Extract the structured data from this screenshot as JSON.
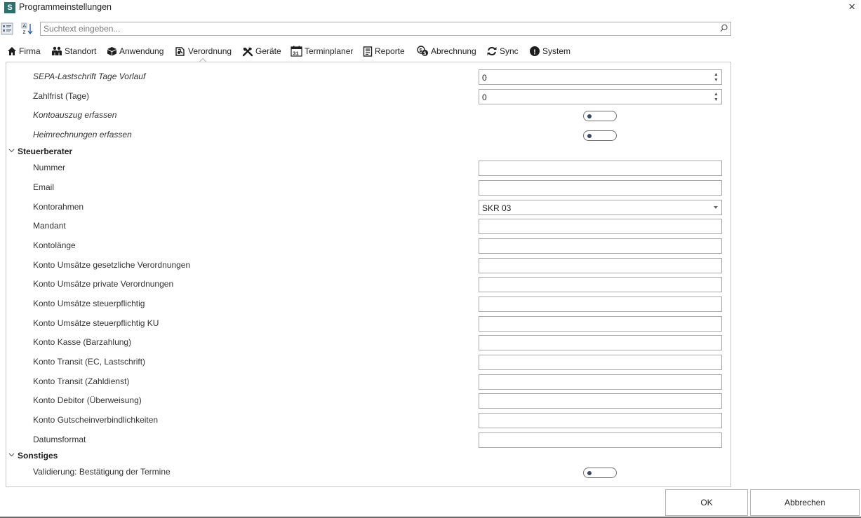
{
  "window": {
    "app_icon_letter": "S",
    "title": "Programmeinstellungen",
    "close_glyph": "×"
  },
  "toolbar": {
    "search_placeholder": "Suchtext eingeben...",
    "categorized_icon": "categorized-view-icon",
    "sort_icon": "sort-alphabetical-icon",
    "search_icon": "magnifier-icon"
  },
  "tabs": [
    {
      "label": "Firma",
      "icon": "home-icon"
    },
    {
      "label": "Standort",
      "icon": "people-icon"
    },
    {
      "label": "Anwendung",
      "icon": "cube-icon"
    },
    {
      "label": "Verordnung",
      "icon": "prescription-icon"
    },
    {
      "label": "Geräte",
      "icon": "tools-icon"
    },
    {
      "label": "Terminplaner",
      "icon": "calendar-icon",
      "calendar_day": "31"
    },
    {
      "label": "Reporte",
      "icon": "report-icon"
    },
    {
      "label": "Abrechnung",
      "icon": "coins-icon"
    },
    {
      "label": "Sync",
      "icon": "sync-icon"
    },
    {
      "label": "System",
      "icon": "exclamation-icon",
      "glyph": "!"
    }
  ],
  "active_tab": "Verordnung",
  "settings": {
    "top_rows": [
      {
        "label": "SEPA-Lastschrift Tage Vorlauf",
        "type": "spin",
        "value": "0"
      },
      {
        "label": "Zahlfrist (Tage)",
        "type": "spin",
        "value": "0"
      },
      {
        "label": "Kontoauszug erfassen",
        "type": "toggle",
        "value": "off"
      },
      {
        "label": "Heimrechnungen erfassen",
        "type": "toggle",
        "value": "off"
      }
    ],
    "steuerberater": {
      "title": "Steuerberater",
      "rows": [
        {
          "label": "Nummer",
          "value": ""
        },
        {
          "label": "Email",
          "value": ""
        },
        {
          "label": "Kontorahmen",
          "value": "SKR 03"
        },
        {
          "label": "Mandant",
          "value": ""
        },
        {
          "label": "Kontolänge",
          "value": ""
        },
        {
          "label": "Konto Umsätze gesetzliche Verordnungen",
          "value": ""
        },
        {
          "label": "Konto Umsätze private Verordnungen",
          "value": ""
        },
        {
          "label": "Konto Umsätze steuerpflichtig",
          "value": ""
        },
        {
          "label": "Konto Umsätze steuerpflichtig KU",
          "value": ""
        },
        {
          "label": "Konto Kasse (Barzahlung)",
          "value": ""
        },
        {
          "label": "Konto Transit (EC, Lastschrift)",
          "value": ""
        },
        {
          "label": "Konto Transit (Zahldienst)",
          "value": ""
        },
        {
          "label": "Konto Debitor (Überweisung)",
          "value": ""
        },
        {
          "label": "Konto Gutscheinverbindlichkeiten",
          "value": ""
        },
        {
          "label": "Datumsformat",
          "value": ""
        }
      ]
    },
    "sonstiges": {
      "title": "Sonstiges",
      "rows": [
        {
          "label": "Validierung: Bestätigung der Termine",
          "type": "toggle",
          "value": "off"
        }
      ]
    }
  },
  "buttons": {
    "ok": "OK",
    "cancel": "Abbrechen"
  },
  "colors": {
    "app_icon_bg": "#2d6f6a",
    "toggle_knob": "#3a4a6b"
  }
}
